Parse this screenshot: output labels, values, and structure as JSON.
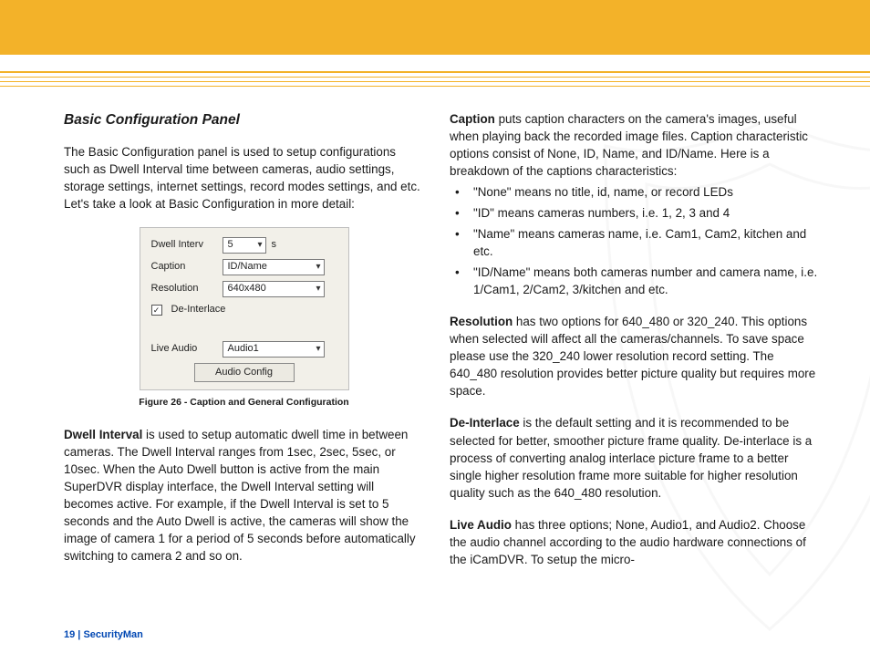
{
  "header": {
    "title": "Basic Configuration Panel",
    "intro": "The Basic Configuration panel is used to setup configurations such as Dwell Interval time between cameras, audio settings, storage settings, internet settings, record modes settings, and etc. Let's take a look at Basic Configuration in more detail:"
  },
  "figure": {
    "labels": {
      "dwell": "Dwell Interv",
      "caption": "Caption",
      "resolution": "Resolution",
      "deinterlace": "De-Interlace",
      "liveaudio": "Live Audio",
      "button": "Audio Config"
    },
    "values": {
      "dwell": "5",
      "dwell_suffix": "s",
      "caption": "ID/Name",
      "resolution": "640x480",
      "liveaudio": "Audio1",
      "check_mark": "✓"
    },
    "caption": "Figure 26 - Caption and General Configuration"
  },
  "left": {
    "dwell_title": "Dwell Interval",
    "dwell_body": " is used to setup automatic dwell time in between cameras.  The Dwell Interval ranges from 1sec, 2sec, 5sec, or 10sec.  When the Auto Dwell button is active from the main SuperDVR display interface, the Dwell Interval setting will becomes active.  For example, if the Dwell Interval is set to 5 seconds and the Auto Dwell is active, the cameras will show the image of camera 1 for a period of 5 seconds before automatically switching to camera 2 and so on."
  },
  "right": {
    "caption_title": "Caption",
    "caption_body": " puts caption characters on the camera's images, useful when playing back the recorded image files. Caption characteristic options consist of None, ID, Name, and ID/Name. Here is a breakdown of the captions characteristics:",
    "bullets": [
      "\"None\" means no title, id, name, or record LEDs",
      "\"ID\" means cameras numbers, i.e. 1, 2, 3 and 4",
      "\"Name\" means cameras name, i.e. Cam1, Cam2, kitchen and etc.",
      "\"ID/Name\" means both cameras number and camera name, i.e. 1/Cam1, 2/Cam2, 3/kitchen and etc."
    ],
    "resolution_title": "Resolution",
    "resolution_body": " has two options for 640_480 or 320_240.  This options when selected will affect all the cameras/channels.  To save space please use the 320_240 lower resolution record setting. The 640_480 resolution provides better picture quality but requires more space.",
    "deinterlace_title": "De-Interlace",
    "deinterlace_body": " is the default setting and it is recommended to be selected for better, smoother picture frame quality. De-interlace is a process of converting analog interlace picture frame to a better single higher resolution frame more suitable for higher resolution quality such as the 640_480 resolution.",
    "liveaudio_title": "Live Audio",
    "liveaudio_body": " has three options; None, Audio1, and Audio2. Choose the audio channel according to the audio hardware connections of the iCamDVR.  To setup the micro-"
  },
  "footer": {
    "page": "19",
    "sep": "  |  ",
    "brand": "SecurityMan"
  }
}
